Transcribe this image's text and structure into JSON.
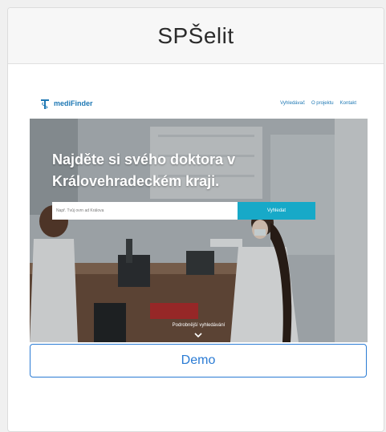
{
  "card": {
    "title": "SPŠelit"
  },
  "site": {
    "brand": "mediFinder",
    "nav": [
      "Vyhledávač",
      "O projektu",
      "Kontakt"
    ],
    "hero_heading": "Najděte si svého doktora v Královehradeckém kraji.",
    "search_placeholder": "Např. Tvůj ovrn ad Králova",
    "search_button": "Vyhledat",
    "advanced_search": "Podrobnější vyhledávání"
  },
  "demo_button": "Demo",
  "colors": {
    "brand": "#1e78b4",
    "search_button": "#17a9c8",
    "demo_border": "#2a7bd4"
  },
  "icons": {
    "brand": "medical-cross-icon",
    "scroll_down": "chevron-down-icon"
  }
}
